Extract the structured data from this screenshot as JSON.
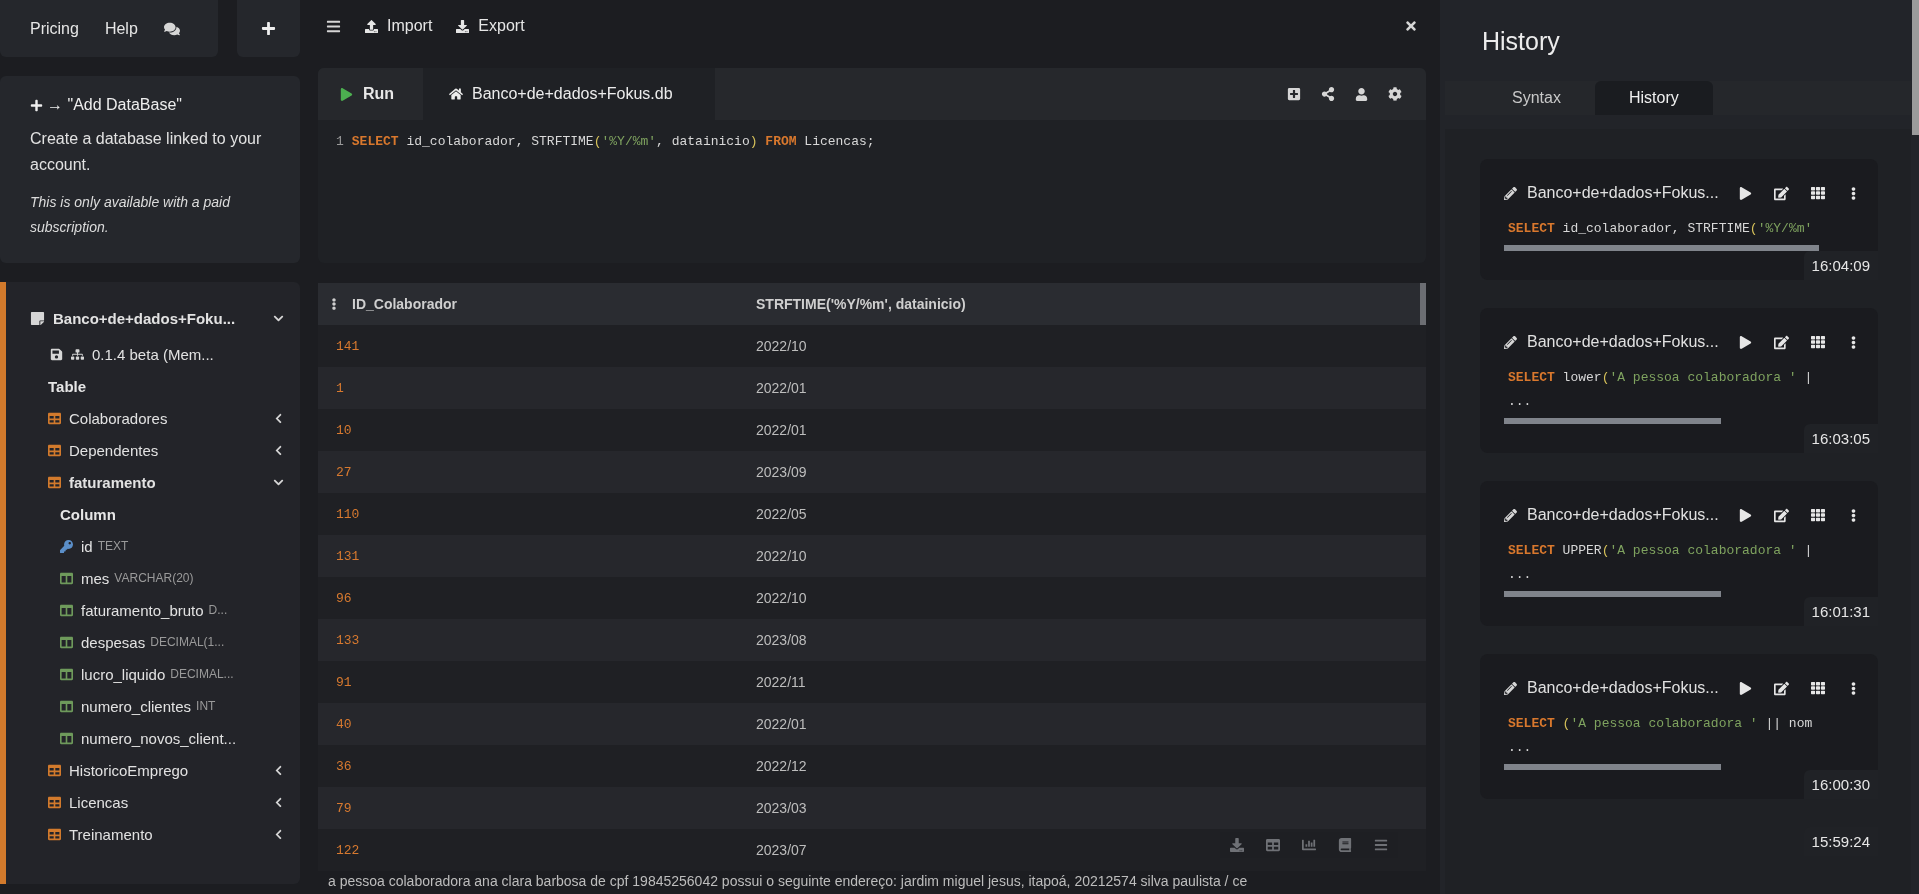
{
  "sidebar": {
    "top_menu": [
      {
        "label": "Pricing"
      },
      {
        "label": "Help"
      }
    ],
    "add_database": {
      "title": "→ \"Add DataBase\"",
      "description": "Create a database linked to your account.",
      "note": "This is only available with a paid subscription."
    },
    "tree": {
      "label": "Banco+de+dados+Foku...",
      "expanded": true,
      "info": "0.1.4 beta (Mem...",
      "section": "Table",
      "tables": [
        {
          "label": "Colaboradores",
          "expanded": false
        },
        {
          "label": "Dependentes",
          "expanded": false
        },
        {
          "label": "faturamento",
          "expanded": true,
          "section": "Column",
          "columns": [
            {
              "name": "id",
              "type": "TEXT",
              "kind": "key"
            },
            {
              "name": "mes",
              "type": "VARCHAR(20)",
              "kind": "column"
            },
            {
              "name": "faturamento_bruto",
              "type": "D...",
              "kind": "column"
            },
            {
              "name": "despesas",
              "type": "DECIMAL(1...",
              "kind": "column"
            },
            {
              "name": "lucro_liquido",
              "type": "DECIMAL...",
              "kind": "column"
            },
            {
              "name": "numero_clientes",
              "type": "INT",
              "kind": "column"
            },
            {
              "name": "numero_novos_client...",
              "kind": "column"
            }
          ]
        },
        {
          "label": "HistoricoEmprego",
          "expanded": false
        },
        {
          "label": "Licencas",
          "expanded": false
        },
        {
          "label": "Treinamento",
          "expanded": false
        }
      ]
    }
  },
  "toolbar": {
    "import": "Import",
    "export": "Export"
  },
  "editor": {
    "run_button": "Run",
    "file_tab": {
      "label": "Banco+de+dados+Fokus.db",
      "selected": true
    },
    "lines": [
      {
        "number": "1",
        "tokens": [
          {
            "kind": "keyword",
            "text": "SELECT"
          },
          {
            "kind": "plain",
            "text": " id_colaborador, STRFTIME"
          },
          {
            "kind": "paren",
            "text": "("
          },
          {
            "kind": "string",
            "text": "'%Y/%m'"
          },
          {
            "kind": "plain",
            "text": ", datainicio"
          },
          {
            "kind": "paren",
            "text": ")"
          },
          {
            "kind": "keyword",
            "text": " FROM"
          },
          {
            "kind": "plain",
            "text": " Licencas;"
          }
        ]
      }
    ]
  },
  "results": {
    "columns": [
      "ID_Colaborador",
      "STRFTIME('%Y/%m', datainicio)"
    ],
    "rows": [
      [
        "141",
        "2022/10"
      ],
      [
        "1",
        "2022/01"
      ],
      [
        "10",
        "2022/01"
      ],
      [
        "27",
        "2023/09"
      ],
      [
        "110",
        "2022/05"
      ],
      [
        "131",
        "2022/10"
      ],
      [
        "96",
        "2022/10"
      ],
      [
        "133",
        "2023/08"
      ],
      [
        "91",
        "2022/11"
      ],
      [
        "40",
        "2022/01"
      ],
      [
        "36",
        "2022/12"
      ],
      [
        "79",
        "2023/03"
      ],
      [
        "122",
        "2023/07"
      ]
    ],
    "overlay_text": "a pessoa colaboradora ana clara barbosa de cpf 19845256042 possui o seguinte endereço: jardim miguel jesus, itapoá, 20212574 silva paulista / ce"
  },
  "history_panel": {
    "title": "History",
    "tabs": [
      {
        "label": "Syntax",
        "selected": false
      },
      {
        "label": "History",
        "selected": true
      }
    ],
    "entries": [
      {
        "database": "Banco+de+dados+Fokus...",
        "lines": [
          [
            {
              "kind": "keyword",
              "text": "SELECT"
            },
            {
              "kind": "plain",
              "text": " id_colaborador, STRFTIME"
            },
            {
              "kind": "paren",
              "text": "("
            },
            {
              "kind": "string",
              "text": "'%Y/%m'"
            }
          ]
        ],
        "time": "16:04:09"
      },
      {
        "database": "Banco+de+dados+Fokus...",
        "lines": [
          [
            {
              "kind": "keyword",
              "text": "SELECT"
            },
            {
              "kind": "plain",
              "text": " lower"
            },
            {
              "kind": "paren",
              "text": "("
            },
            {
              "kind": "string",
              "text": "'A pessoa colaboradora '"
            },
            {
              "kind": "plain",
              "text": " |"
            }
          ],
          [
            {
              "kind": "plain",
              "text": "..."
            }
          ]
        ],
        "time": "16:03:05"
      },
      {
        "database": "Banco+de+dados+Fokus...",
        "lines": [
          [
            {
              "kind": "keyword",
              "text": "SELECT"
            },
            {
              "kind": "plain",
              "text": " UPPER"
            },
            {
              "kind": "paren",
              "text": "("
            },
            {
              "kind": "string",
              "text": "'A pessoa colaboradora '"
            },
            {
              "kind": "plain",
              "text": " |"
            }
          ],
          [
            {
              "kind": "plain",
              "text": "..."
            }
          ]
        ],
        "time": "16:01:31"
      },
      {
        "database": "Banco+de+dados+Fokus...",
        "lines": [
          [
            {
              "kind": "keyword",
              "text": "SELECT"
            },
            {
              "kind": "paren",
              "text": " ("
            },
            {
              "kind": "string",
              "text": "'A pessoa colaboradora '"
            },
            {
              "kind": "plain",
              "text": " || nom"
            }
          ],
          [
            {
              "kind": "plain",
              "text": "..."
            }
          ]
        ],
        "time": "16:00:30"
      },
      {
        "time": "15:59:24"
      }
    ]
  }
}
